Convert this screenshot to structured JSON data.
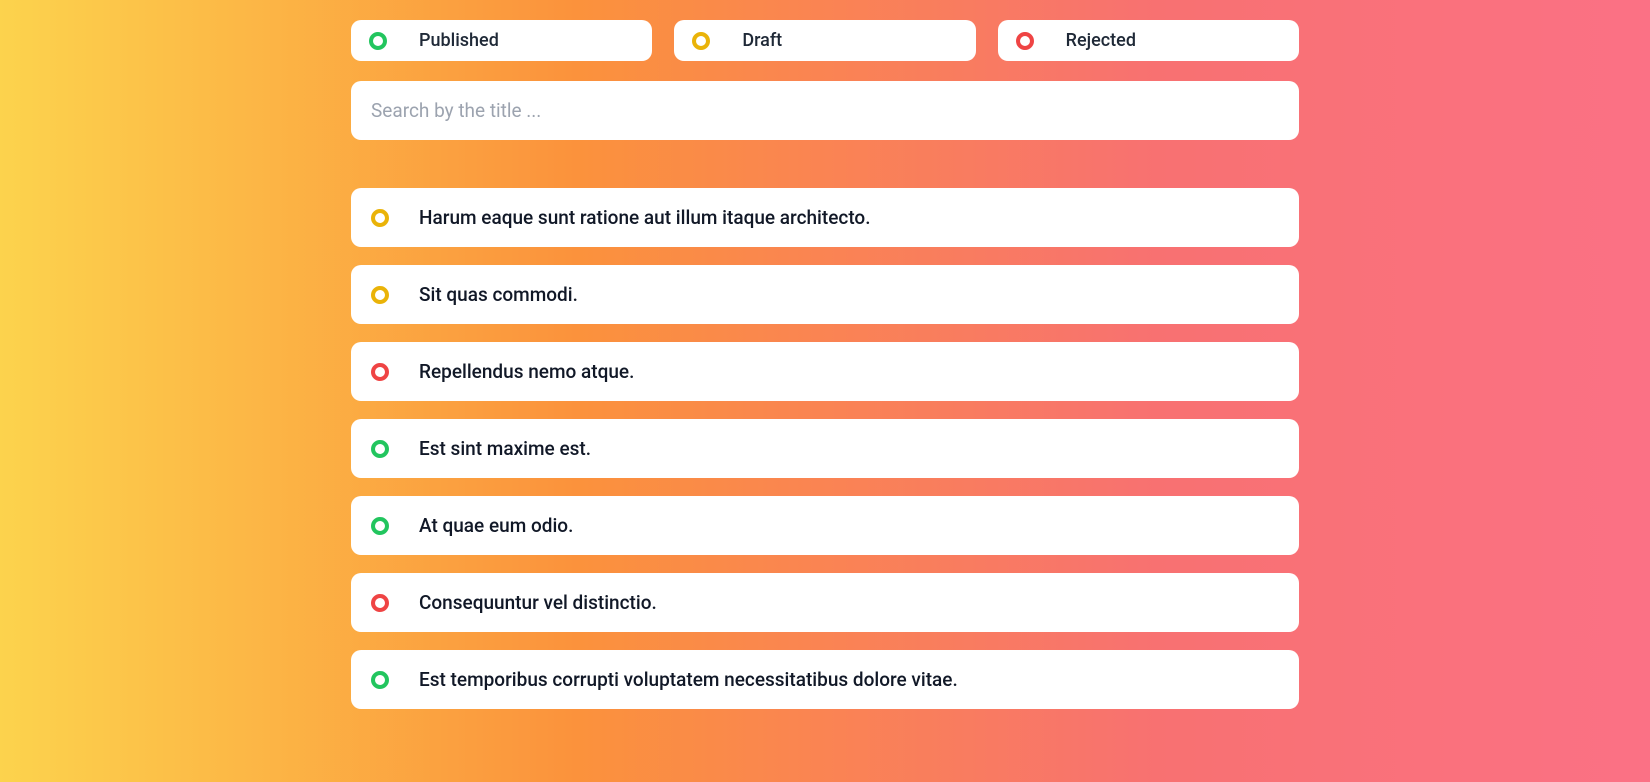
{
  "filters": [
    {
      "label": "Published",
      "status": "published"
    },
    {
      "label": "Draft",
      "status": "draft"
    },
    {
      "label": "Rejected",
      "status": "rejected"
    }
  ],
  "search": {
    "placeholder": "Search by the title ...",
    "value": ""
  },
  "status_colors": {
    "published": "#22c55e",
    "draft": "#eab308",
    "rejected": "#ef4444"
  },
  "items": [
    {
      "status": "draft",
      "title": "Harum eaque sunt ratione aut illum itaque architecto."
    },
    {
      "status": "draft",
      "title": "Sit quas commodi."
    },
    {
      "status": "rejected",
      "title": "Repellendus nemo atque."
    },
    {
      "status": "published",
      "title": "Est sint maxime est."
    },
    {
      "status": "published",
      "title": "At quae eum odio."
    },
    {
      "status": "rejected",
      "title": "Consequuntur vel distinctio."
    },
    {
      "status": "published",
      "title": "Est temporibus corrupti voluptatem necessitatibus dolore vitae."
    }
  ]
}
